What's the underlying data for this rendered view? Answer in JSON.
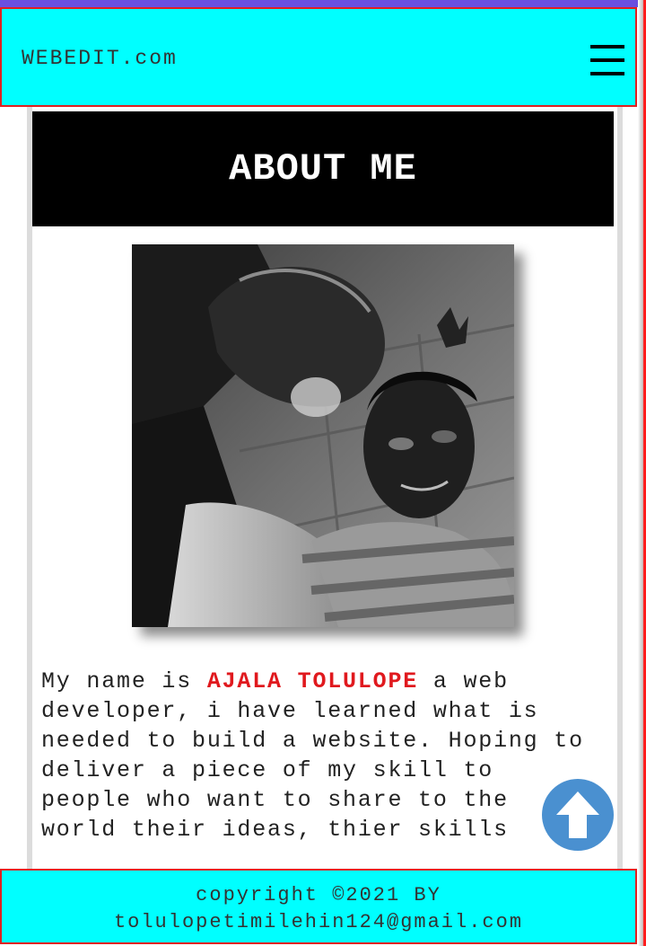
{
  "header": {
    "brand": "WEBEDIT.com",
    "menu_icon": "hamburger-menu-icon"
  },
  "about": {
    "title": "ABOUT ME",
    "photo_alt": "AJALA TOLULOPE"
  },
  "bio": {
    "intro": "My name is ",
    "name": "AJALA TOLULOPE",
    "text": " a web developer, i have learned what is needed to build a website. Hoping to deliver a piece of my skill to people who want to share to the world their ideas, thier skills"
  },
  "scroll_top": {
    "icon": "arrow-up-icon",
    "color": "#4a90d0"
  },
  "footer": {
    "line1": "copyright ©2021 BY",
    "line2": "tolulopetimilehin124@gmail.com"
  },
  "colors": {
    "header_bg": "#00ffff",
    "border_accent": "#e02020",
    "name_accent": "#e0191e",
    "banner_bg": "#000000"
  }
}
